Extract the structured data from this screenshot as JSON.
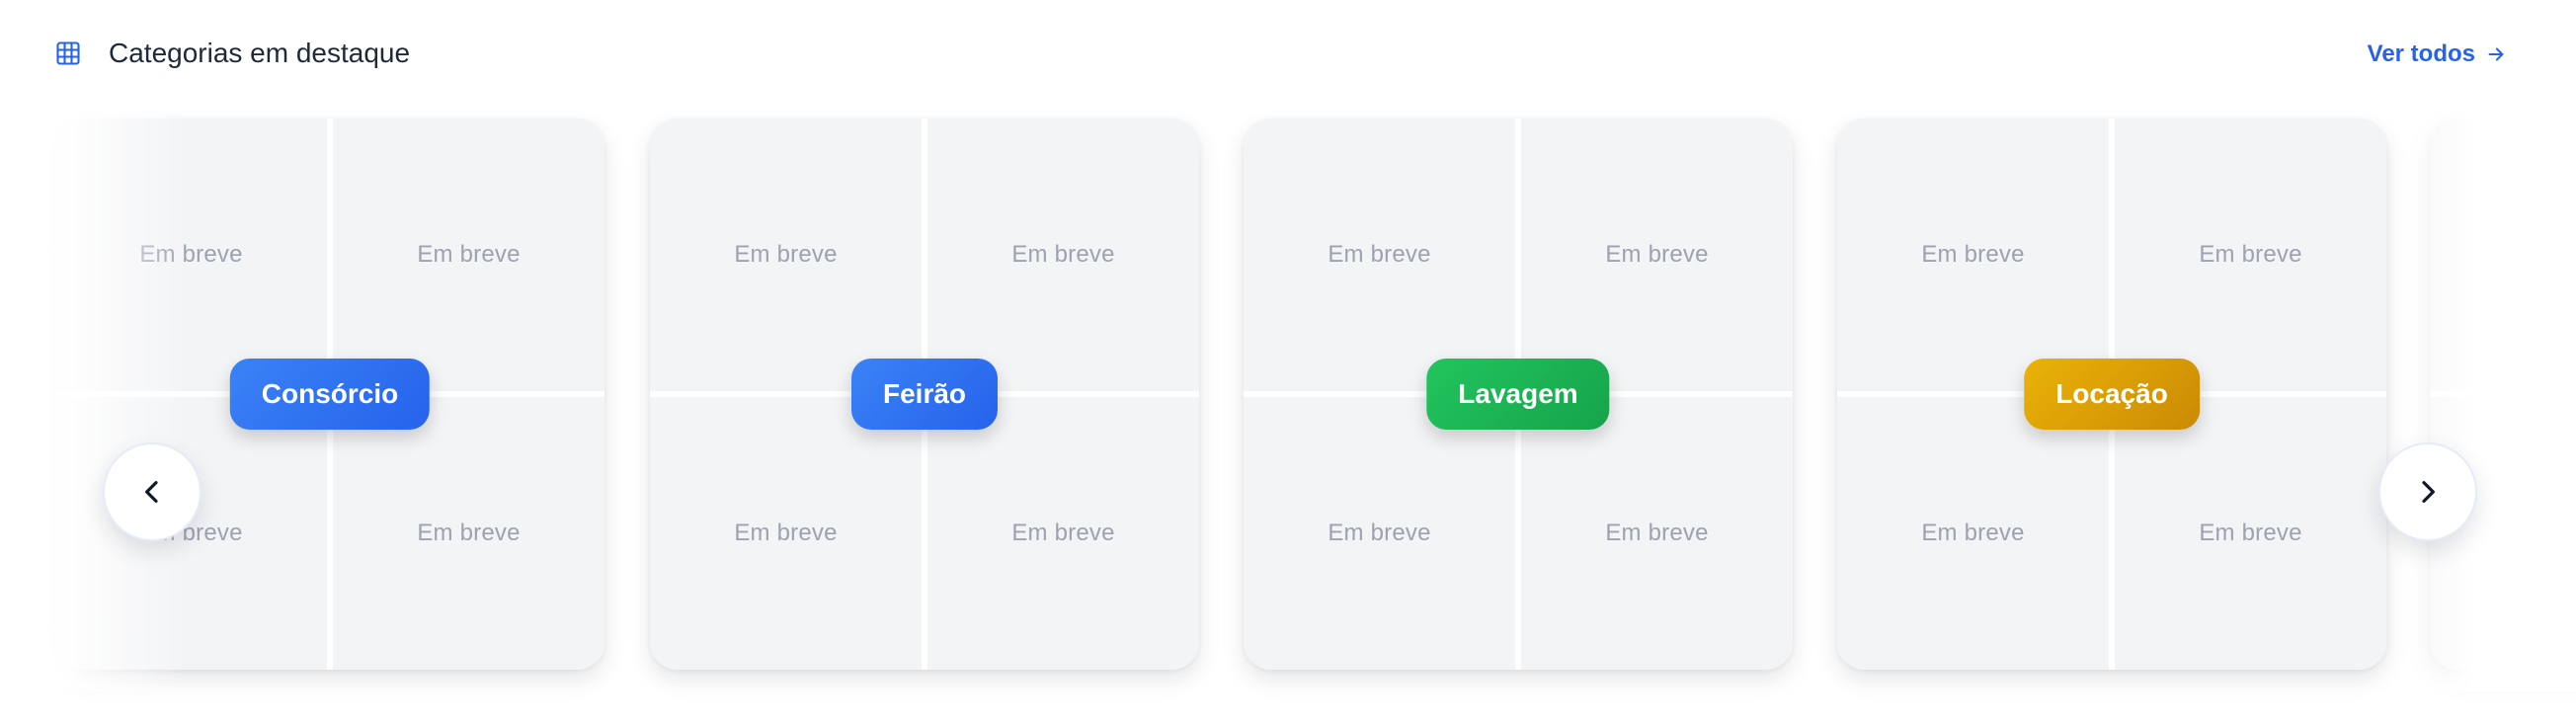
{
  "section": {
    "title": "Categorias em destaque",
    "see_all_label": "Ver todos"
  },
  "icons": {
    "section": "grid-icon",
    "see_all": "arrow-right-icon",
    "prev": "chevron-left-icon",
    "next": "chevron-right-icon"
  },
  "placeholder_text": "Em breve",
  "categories": [
    {
      "label": "Consórcio",
      "color": "#2563eb",
      "tiles": [
        "Em breve",
        "Em breve",
        "Em breve",
        "Em breve"
      ]
    },
    {
      "label": "Feirão",
      "color": "#2563eb",
      "tiles": [
        "Em breve",
        "Em breve",
        "Em breve",
        "Em breve"
      ]
    },
    {
      "label": "Lavagem",
      "color": "#16a34a",
      "tiles": [
        "Em breve",
        "Em breve",
        "Em breve",
        "Em breve"
      ]
    },
    {
      "label": "Locação",
      "color": "#ca8a04",
      "tiles": [
        "Em breve",
        "Em breve",
        "Em breve",
        "Em breve"
      ]
    }
  ],
  "colors": {
    "accent": "#2563eb",
    "tile_bg": "#f3f4f6",
    "tile_text": "#9ca3af",
    "title_text": "#1f2937"
  }
}
